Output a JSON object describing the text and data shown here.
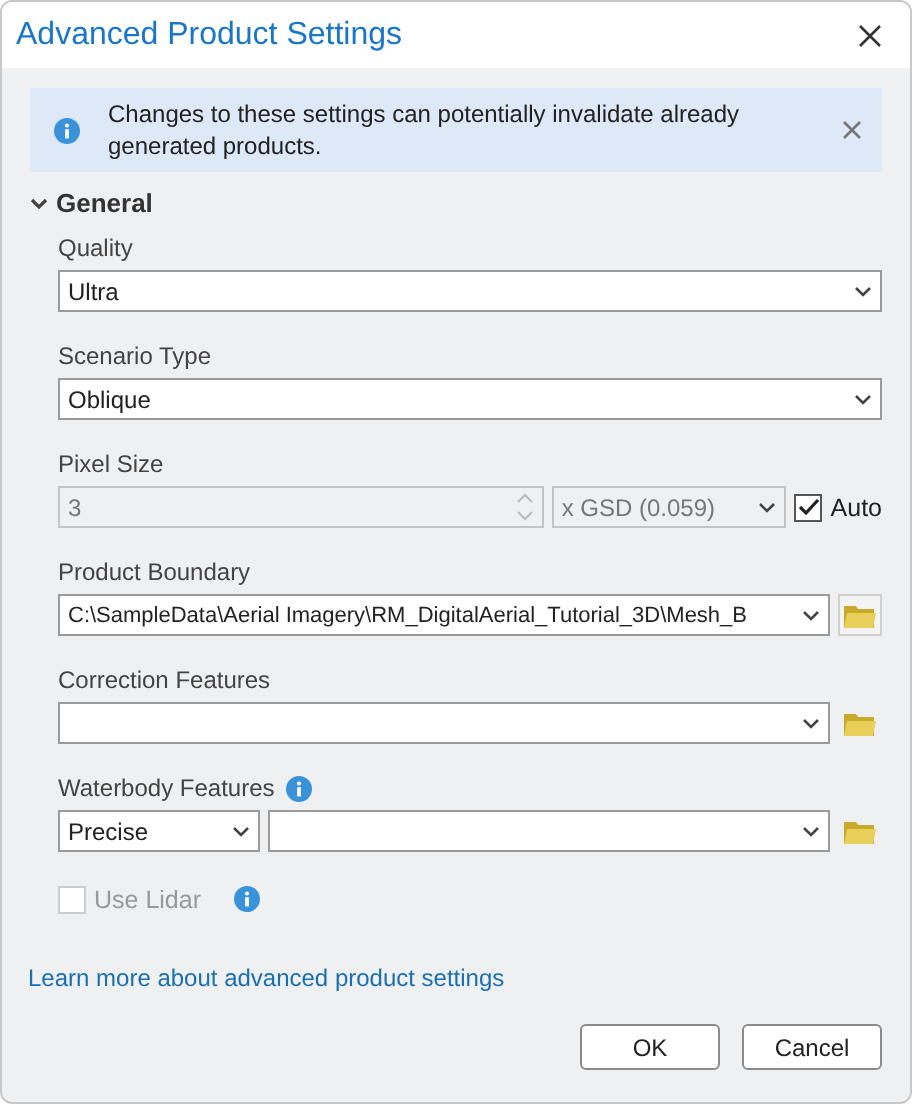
{
  "window": {
    "title": "Advanced Product Settings"
  },
  "banner": {
    "message": "Changes to these settings can potentially invalidate already generated products."
  },
  "section": {
    "title": "General",
    "expanded": true
  },
  "fields": [
    {
      "kind": "select",
      "label": "Quality",
      "value": "Ultra"
    },
    {
      "kind": "select",
      "label": "Scenario Type",
      "value": "Oblique"
    },
    {
      "kind": "pixel",
      "label": "Pixel Size",
      "value": "3",
      "unit": "x GSD (0.059)",
      "disabled": true,
      "checkbox": {
        "label": "Auto",
        "checked": true
      }
    },
    {
      "kind": "path",
      "label": "Product Boundary",
      "value": "C:\\SampleData\\Aerial Imagery\\RM_DigitalAerial_Tutorial_3D\\Mesh_B"
    },
    {
      "kind": "path",
      "label": "Correction Features"
    },
    {
      "kind": "combo",
      "label": "Waterbody Features",
      "info": true,
      "value": "Precise"
    },
    {
      "kind": "checkbox",
      "label": "Use Lidar",
      "checked": false,
      "disabled": true,
      "info": true
    }
  ],
  "link": "Learn more about advanced product settings",
  "buttons": [
    "OK",
    "Cancel"
  ]
}
